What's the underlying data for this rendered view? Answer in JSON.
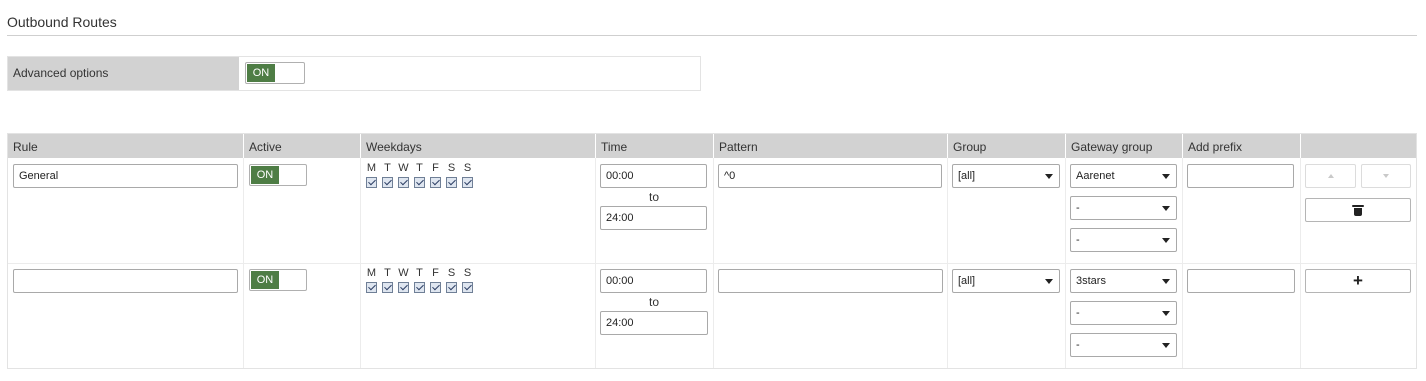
{
  "page": {
    "title": "Outbound Routes"
  },
  "advanced": {
    "label": "Advanced options",
    "toggle_label": "ON"
  },
  "table": {
    "headers": {
      "rule": "Rule",
      "active": "Active",
      "weekdays": "Weekdays",
      "time": "Time",
      "pattern": "Pattern",
      "group": "Group",
      "gateway_group": "Gateway group",
      "add_prefix": "Add prefix"
    },
    "day_letters": [
      "M",
      "T",
      "W",
      "T",
      "F",
      "S",
      "S"
    ],
    "to_label": "to",
    "rows": [
      {
        "rule": "General",
        "active_label": "ON",
        "time_from": "00:00",
        "time_to": "24:00",
        "pattern": "^0",
        "group": "[all]",
        "gateways": [
          "Aarenet",
          "-",
          "-"
        ],
        "prefix": ""
      },
      {
        "rule": "",
        "active_label": "ON",
        "time_from": "00:00",
        "time_to": "24:00",
        "pattern": "",
        "group": "[all]",
        "gateways": [
          "3stars",
          "-",
          "-"
        ],
        "prefix": ""
      }
    ],
    "icons": {
      "move_up": "chevron-up-icon",
      "move_down": "chevron-down-icon",
      "delete": "trash-icon",
      "add": "plus-icon"
    },
    "add_symbol": "+"
  }
}
